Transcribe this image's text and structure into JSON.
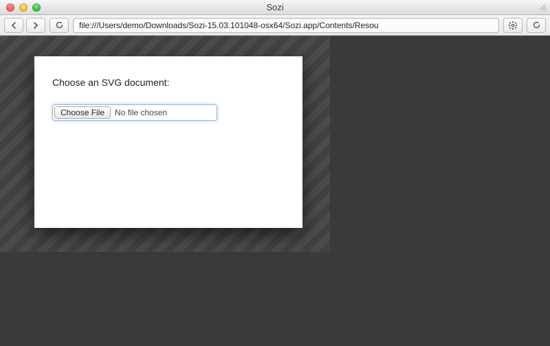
{
  "window": {
    "title": "Sozi"
  },
  "toolbar": {
    "url": "file:///Users/demo/Downloads/Sozi-15.03.101048-osx64/Sozi.app/Contents/Resou"
  },
  "dialog": {
    "prompt": "Choose an SVG document:",
    "choose_file_label": "Choose File",
    "file_status": "No file chosen"
  }
}
